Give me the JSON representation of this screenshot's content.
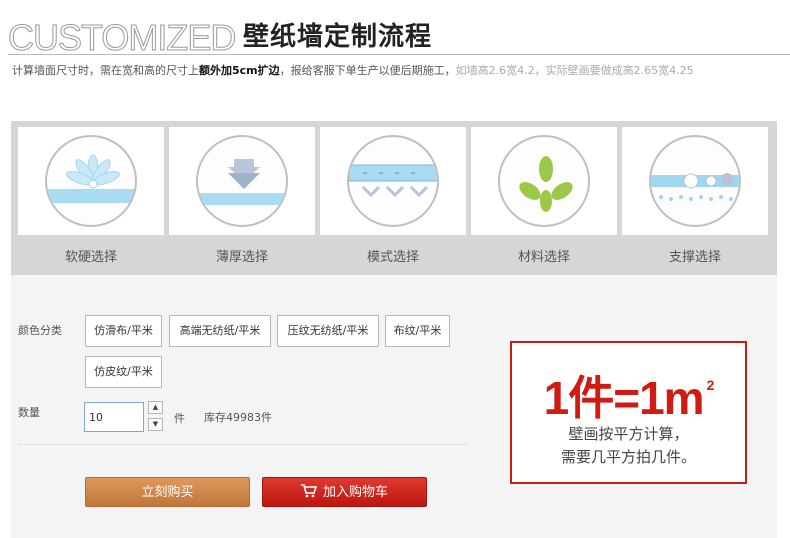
{
  "header": {
    "title_en": "CUSTOMIZED",
    "title_cn": "壁纸墙定制流程"
  },
  "note": {
    "part1": "计算墙面尺寸时，需在宽和高的尺寸上",
    "part2": "额外加5cm扩边",
    "part3": "，报给客服下单生产以便后期施工，",
    "part4": "如墙高2.6宽4.2，实际壁画要做成高2.65宽4.25"
  },
  "steps": [
    {
      "label": "软硬选择",
      "icon": "flower-layer-icon"
    },
    {
      "label": "薄厚选择",
      "icon": "down-arrow-layer-icon"
    },
    {
      "label": "模式选择",
      "icon": "chevron-pattern-icon"
    },
    {
      "label": "材料选择",
      "icon": "leaves-icon"
    },
    {
      "label": "支撑选择",
      "icon": "bubble-support-icon"
    }
  ],
  "product": {
    "color_label": "颜色分类",
    "options": [
      "仿滑布/平米",
      "高端无纺纸/平米",
      "压纹无纺纸/平米",
      "布纹/平米",
      "仿皮纹/平米"
    ],
    "qty_label": "数量",
    "qty_value": "10",
    "unit": "件",
    "stock": "库存49983件",
    "buy_label": "立刻购买",
    "cart_label": "加入购物车"
  },
  "promo": {
    "big": "1件=1m",
    "sup": "2",
    "line1": "壁画按平方计算，",
    "line2": "需要几平方拍几件。"
  },
  "colors": {
    "accent_red": "#cf1b12",
    "buy_orange": "#d08a4e",
    "cart_red": "#cc2319",
    "icon_blue": "#9fd6f0"
  }
}
